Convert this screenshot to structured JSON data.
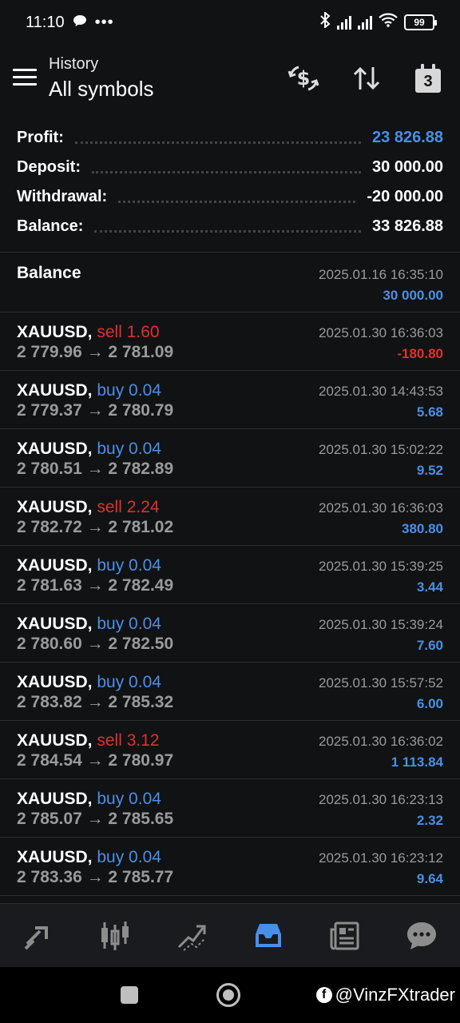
{
  "status_bar": {
    "time": "11:10",
    "battery": "99"
  },
  "header": {
    "title": "History",
    "subtitle": "All symbols",
    "calendar_day": "3"
  },
  "summary": [
    {
      "label": "Profit:",
      "value": "23 826.88",
      "color": "blue"
    },
    {
      "label": "Deposit:",
      "value": "30 000.00",
      "color": "white"
    },
    {
      "label": "Withdrawal:",
      "value": "-20 000.00",
      "color": "white"
    },
    {
      "label": "Balance:",
      "value": "33 826.88",
      "color": "white"
    }
  ],
  "balance_entry": {
    "label": "Balance",
    "time": "2025.01.16 16:35:10",
    "amount": "30 000.00"
  },
  "deals": [
    {
      "symbol": "XAUUSD,",
      "side": "sell 1.60",
      "prices": "2 779.96 → 2 781.09",
      "time": "2025.01.30 16:36:03",
      "profit": "-180.80"
    },
    {
      "symbol": "XAUUSD,",
      "side": "buy 0.04",
      "prices": "2 779.37 → 2 780.79",
      "time": "2025.01.30 14:43:53",
      "profit": "5.68"
    },
    {
      "symbol": "XAUUSD,",
      "side": "buy 0.04",
      "prices": "2 780.51 → 2 782.89",
      "time": "2025.01.30 15:02:22",
      "profit": "9.52"
    },
    {
      "symbol": "XAUUSD,",
      "side": "sell 2.24",
      "prices": "2 782.72 → 2 781.02",
      "time": "2025.01.30 16:36:03",
      "profit": "380.80"
    },
    {
      "symbol": "XAUUSD,",
      "side": "buy 0.04",
      "prices": "2 781.63 → 2 782.49",
      "time": "2025.01.30 15:39:25",
      "profit": "3.44"
    },
    {
      "symbol": "XAUUSD,",
      "side": "buy 0.04",
      "prices": "2 780.60 → 2 782.50",
      "time": "2025.01.30 15:39:24",
      "profit": "7.60"
    },
    {
      "symbol": "XAUUSD,",
      "side": "buy 0.04",
      "prices": "2 783.82 → 2 785.32",
      "time": "2025.01.30 15:57:52",
      "profit": "6.00"
    },
    {
      "symbol": "XAUUSD,",
      "side": "sell 3.12",
      "prices": "2 784.54 → 2 780.97",
      "time": "2025.01.30 16:36:02",
      "profit": "1 113.84"
    },
    {
      "symbol": "XAUUSD,",
      "side": "buy 0.04",
      "prices": "2 785.07 → 2 785.65",
      "time": "2025.01.30 16:23:13",
      "profit": "2.32"
    },
    {
      "symbol": "XAUUSD,",
      "side": "buy 0.04",
      "prices": "2 783.36 → 2 785.77",
      "time": "2025.01.30 16:23:12",
      "profit": "9.64"
    }
  ],
  "bottom_nav": [
    {
      "icon": "quotes-icon",
      "active": false
    },
    {
      "icon": "chart-icon",
      "active": false
    },
    {
      "icon": "trade-icon",
      "active": false
    },
    {
      "icon": "history-icon",
      "active": true
    },
    {
      "icon": "news-icon",
      "active": false
    },
    {
      "icon": "messages-icon",
      "active": false
    }
  ],
  "watermark": "@VinzFXtrader",
  "colors": {
    "background": "#111214",
    "blue": "#4a8fe7",
    "red": "#e0302f",
    "muted": "#9a9a9a"
  }
}
